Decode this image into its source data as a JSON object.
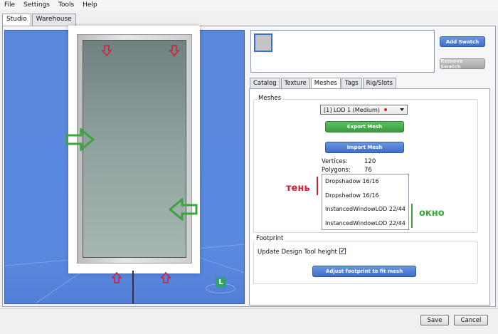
{
  "menu": [
    "File",
    "Settings",
    "Tools",
    "Help"
  ],
  "app_tabs": [
    "Studio",
    "Warehouse"
  ],
  "swatch": {
    "add_label": "Add Swatch",
    "remove_label": "Remove Swatch"
  },
  "sub_tabs": [
    "Catalog",
    "Texture",
    "Meshes",
    "Tags",
    "Rig/Slots"
  ],
  "meshes": {
    "group_title": "Meshes",
    "lod_selected": "[1] LOD 1 (Medium)",
    "export_label": "Export Mesh",
    "import_label": "Import Mesh",
    "vertices_label": "Vertices:",
    "vertices_value": "120",
    "polygons_label": "Polygons:",
    "polygons_value": "76",
    "groups": [
      "Dropshadow 16/16",
      "Dropshadow 16/16",
      "InstancedWindowLOD 22/44",
      "InstancedWindowLOD 22/44"
    ]
  },
  "annotations": {
    "shadow": "тень",
    "window": "окно"
  },
  "footprint": {
    "group_title": "Footprint",
    "update_label": "Update Design Tool height",
    "update_checked": "✔",
    "adjust_label": "Adjust footprint to fit mesh"
  },
  "viewport": {
    "badge": "L"
  },
  "footer": {
    "save_label": "Save",
    "cancel_label": "Cancel"
  },
  "colors": {
    "viewport_bg": "#5a8ae0",
    "accent_blue": "#3f6fca",
    "accent_green": "#3a9a3f",
    "annotation_red": "#d0213a",
    "annotation_green": "#3aa63a"
  }
}
